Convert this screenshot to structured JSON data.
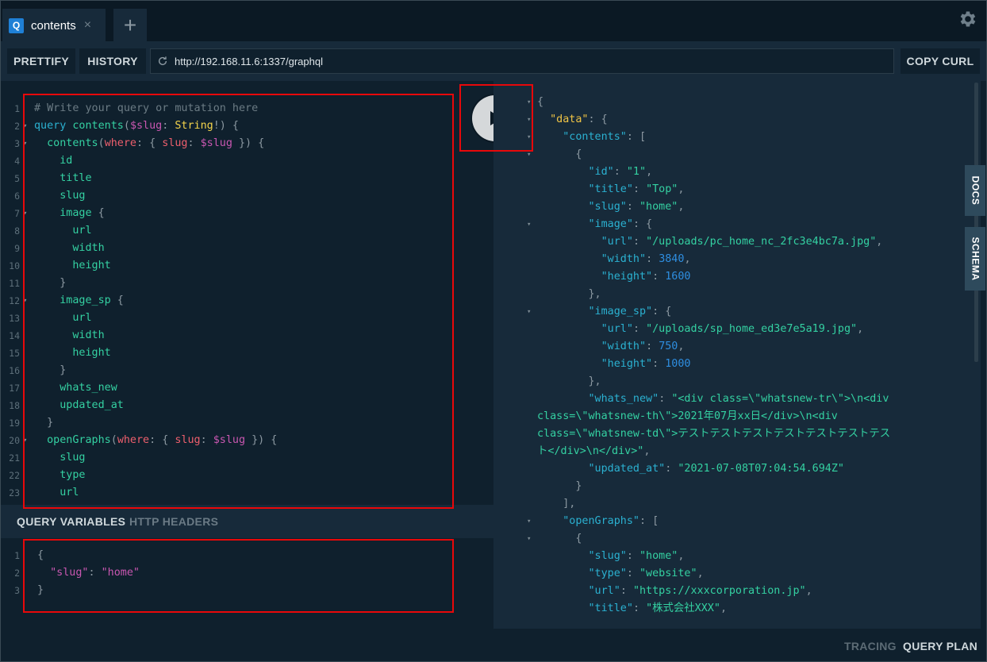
{
  "tab": {
    "logo": "Q",
    "label": "contents",
    "close": "×",
    "add": "+"
  },
  "toolbar": {
    "prettify": "PRETTIFY",
    "history": "HISTORY",
    "url": "http://192.168.11.6:1337/graphql",
    "copy_curl": "COPY CURL"
  },
  "query_lines": [
    [
      [
        "c-comment",
        "# Write your query or mutation here"
      ]
    ],
    [
      [
        "c-kw",
        "query "
      ],
      [
        "c-def",
        "contents"
      ],
      [
        "c-punc",
        "("
      ],
      [
        "c-var",
        "$slug"
      ],
      [
        "c-punc",
        ": "
      ],
      [
        "c-type",
        "String"
      ],
      [
        "c-punc",
        "!) {"
      ]
    ],
    [
      [
        "c-field",
        "  contents"
      ],
      [
        "c-punc",
        "("
      ],
      [
        "c-attr",
        "where"
      ],
      [
        "c-punc",
        ": { "
      ],
      [
        "c-attr",
        "slug"
      ],
      [
        "c-punc",
        ": "
      ],
      [
        "c-var",
        "$slug"
      ],
      [
        "c-punc",
        " }) {"
      ]
    ],
    [
      [
        "c-field",
        "    id"
      ]
    ],
    [
      [
        "c-field",
        "    title"
      ]
    ],
    [
      [
        "c-field",
        "    slug"
      ]
    ],
    [
      [
        "c-field",
        "    image"
      ],
      [
        "c-punc",
        " {"
      ]
    ],
    [
      [
        "c-field",
        "      url"
      ]
    ],
    [
      [
        "c-field",
        "      width"
      ]
    ],
    [
      [
        "c-field",
        "      height"
      ]
    ],
    [
      [
        "c-punc",
        "    }"
      ]
    ],
    [
      [
        "c-field",
        "    image_sp"
      ],
      [
        "c-punc",
        " {"
      ]
    ],
    [
      [
        "c-field",
        "      url"
      ]
    ],
    [
      [
        "c-field",
        "      width"
      ]
    ],
    [
      [
        "c-field",
        "      height"
      ]
    ],
    [
      [
        "c-punc",
        "    }"
      ]
    ],
    [
      [
        "c-field",
        "    whats_new"
      ]
    ],
    [
      [
        "c-field",
        "    updated_at"
      ]
    ],
    [
      [
        "c-punc",
        "  }"
      ]
    ],
    [
      [
        "c-field",
        "  openGraphs"
      ],
      [
        "c-punc",
        "("
      ],
      [
        "c-attr",
        "where"
      ],
      [
        "c-punc",
        ": { "
      ],
      [
        "c-attr",
        "slug"
      ],
      [
        "c-punc",
        ": "
      ],
      [
        "c-var",
        "$slug"
      ],
      [
        "c-punc",
        " }) {"
      ]
    ],
    [
      [
        "c-field",
        "    slug"
      ]
    ],
    [
      [
        "c-field",
        "    type"
      ]
    ],
    [
      [
        "c-field",
        "    url"
      ]
    ]
  ],
  "query_folds": [
    2,
    3,
    7,
    12,
    20
  ],
  "variables": {
    "tab_active": "QUERY VARIABLES",
    "tab_inactive": "HTTP HEADERS",
    "lines": [
      [
        [
          "c-punc",
          "{"
        ]
      ],
      [
        [
          "c-key",
          "  \"slug\""
        ],
        [
          "c-punc",
          ": "
        ],
        [
          "c-str",
          "\"home\""
        ]
      ],
      [
        [
          "c-punc",
          "}"
        ]
      ]
    ]
  },
  "result_lines": [
    [
      [
        "r-punc",
        "{"
      ]
    ],
    [
      [
        "r-key-top",
        "  \"data\""
      ],
      [
        "r-punc",
        ": {"
      ]
    ],
    [
      [
        "r-key",
        "    \"contents\""
      ],
      [
        "r-punc",
        ": ["
      ]
    ],
    [
      [
        "r-punc",
        "      {"
      ]
    ],
    [
      [
        "r-key",
        "        \"id\""
      ],
      [
        "r-punc",
        ": "
      ],
      [
        "r-str",
        "\"1\""
      ],
      [
        "r-punc",
        ","
      ]
    ],
    [
      [
        "r-key",
        "        \"title\""
      ],
      [
        "r-punc",
        ": "
      ],
      [
        "r-str",
        "\"Top\""
      ],
      [
        "r-punc",
        ","
      ]
    ],
    [
      [
        "r-key",
        "        \"slug\""
      ],
      [
        "r-punc",
        ": "
      ],
      [
        "r-str",
        "\"home\""
      ],
      [
        "r-punc",
        ","
      ]
    ],
    [
      [
        "r-key",
        "        \"image\""
      ],
      [
        "r-punc",
        ": {"
      ]
    ],
    [
      [
        "r-key",
        "          \"url\""
      ],
      [
        "r-punc",
        ": "
      ],
      [
        "r-str",
        "\"/uploads/pc_home_nc_2fc3e4bc7a.jpg\""
      ],
      [
        "r-punc",
        ","
      ]
    ],
    [
      [
        "r-key",
        "          \"width\""
      ],
      [
        "r-punc",
        ": "
      ],
      [
        "r-num",
        "3840"
      ],
      [
        "r-punc",
        ","
      ]
    ],
    [
      [
        "r-key",
        "          \"height\""
      ],
      [
        "r-punc",
        ": "
      ],
      [
        "r-num",
        "1600"
      ]
    ],
    [
      [
        "r-punc",
        "        },"
      ]
    ],
    [
      [
        "r-key",
        "        \"image_sp\""
      ],
      [
        "r-punc",
        ": {"
      ]
    ],
    [
      [
        "r-key",
        "          \"url\""
      ],
      [
        "r-punc",
        ": "
      ],
      [
        "r-str",
        "\"/uploads/sp_home_ed3e7e5a19.jpg\""
      ],
      [
        "r-punc",
        ","
      ]
    ],
    [
      [
        "r-key",
        "          \"width\""
      ],
      [
        "r-punc",
        ": "
      ],
      [
        "r-num",
        "750"
      ],
      [
        "r-punc",
        ","
      ]
    ],
    [
      [
        "r-key",
        "          \"height\""
      ],
      [
        "r-punc",
        ": "
      ],
      [
        "r-num",
        "1000"
      ]
    ],
    [
      [
        "r-punc",
        "        },"
      ]
    ],
    [
      [
        "r-key",
        "        \"whats_new\""
      ],
      [
        "r-punc",
        ": "
      ],
      [
        "r-str",
        "\"<div class=\\\"whatsnew-tr\\\">\\n<div"
      ]
    ],
    [
      [
        "r-str",
        "class=\\\"whatsnew-th\\\">2021年07月xx日</div>\\n<div"
      ]
    ],
    [
      [
        "r-str",
        "class=\\\"whatsnew-td\\\">テストテストテストテストテストテストテス"
      ]
    ],
    [
      [
        "r-str",
        "ト</div>\\n</div>\""
      ],
      [
        "r-punc",
        ","
      ]
    ],
    [
      [
        "r-key",
        "        \"updated_at\""
      ],
      [
        "r-punc",
        ": "
      ],
      [
        "r-str",
        "\"2021-07-08T07:04:54.694Z\""
      ]
    ],
    [
      [
        "r-punc",
        "      }"
      ]
    ],
    [
      [
        "r-punc",
        "    ],"
      ]
    ],
    [
      [
        "r-key",
        "    \"openGraphs\""
      ],
      [
        "r-punc",
        ": ["
      ]
    ],
    [
      [
        "r-punc",
        "      {"
      ]
    ],
    [
      [
        "r-key",
        "        \"slug\""
      ],
      [
        "r-punc",
        ": "
      ],
      [
        "r-str",
        "\"home\""
      ],
      [
        "r-punc",
        ","
      ]
    ],
    [
      [
        "r-key",
        "        \"type\""
      ],
      [
        "r-punc",
        ": "
      ],
      [
        "r-str",
        "\"website\""
      ],
      [
        "r-punc",
        ","
      ]
    ],
    [
      [
        "r-key",
        "        \"url\""
      ],
      [
        "r-punc",
        ": "
      ],
      [
        "r-str",
        "\"https://xxxcorporation.jp\""
      ],
      [
        "r-punc",
        ","
      ]
    ],
    [
      [
        "r-key",
        "        \"title\""
      ],
      [
        "r-punc",
        ": "
      ],
      [
        "r-str",
        "\"株式会社XXX\""
      ],
      [
        "r-punc",
        ","
      ]
    ]
  ],
  "result_folds": [
    1,
    2,
    3,
    4,
    8,
    13,
    25,
    26
  ],
  "side_tabs": {
    "docs": "DOCS",
    "schema": "SCHEMA"
  },
  "footer": {
    "tracing": "TRACING",
    "query_plan": "QUERY PLAN"
  },
  "icons": {
    "settings": "gear-icon",
    "reload": "reload-icon",
    "run": "play-icon"
  },
  "colors": {
    "accent": "#1f80d6",
    "highlight": "#e8080a"
  }
}
